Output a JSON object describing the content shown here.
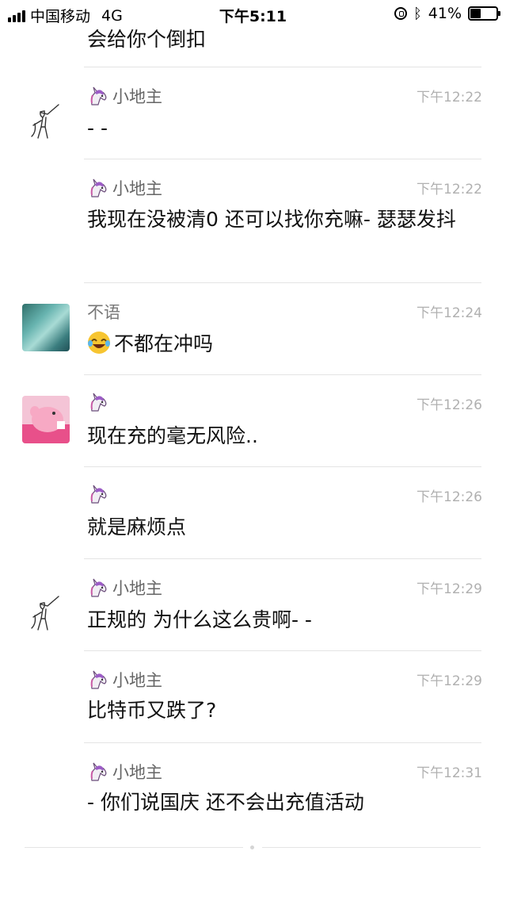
{
  "status_bar": {
    "carrier": "中国移动",
    "network": "4G",
    "time": "下午5:11",
    "battery_percent": "41%",
    "battery_level": 0.41,
    "icons": [
      "signal-icon",
      "orientation-lock-icon",
      "bluetooth-icon",
      "battery-icon"
    ]
  },
  "top_partial_text": "会给你个倒扣",
  "messages": [
    {
      "avatar": "dab-sketch",
      "sender": "小地主",
      "time": "下午12:22",
      "text": "- -"
    },
    {
      "avatar": "",
      "sender": "小地主",
      "time": "下午12:22",
      "text": "我现在没被清0  还可以找你充嘛- 瑟瑟发抖"
    },
    {
      "avatar": "teal-watercolor",
      "sender": "不语",
      "time": "下午12:24",
      "emoji": "face-with-tears-of-joy-icon",
      "text": "不都在冲吗"
    },
    {
      "avatar": "pink-cartoon",
      "sender": "",
      "time": "下午12:26",
      "text": "现在充的毫无风险.."
    },
    {
      "avatar": "",
      "sender": "",
      "time": "下午12:26",
      "text": "就是麻烦点"
    },
    {
      "avatar": "dab-sketch",
      "sender": "小地主",
      "time": "下午12:29",
      "text": "正规的 为什么这么贵啊- -"
    },
    {
      "avatar": "",
      "sender": "小地主",
      "time": "下午12:29",
      "text": "比特币又跌了?"
    },
    {
      "avatar": "",
      "sender": "小地主",
      "time": "下午12:31",
      "text": "- 你们说国庆 还不会出充值活动"
    }
  ]
}
